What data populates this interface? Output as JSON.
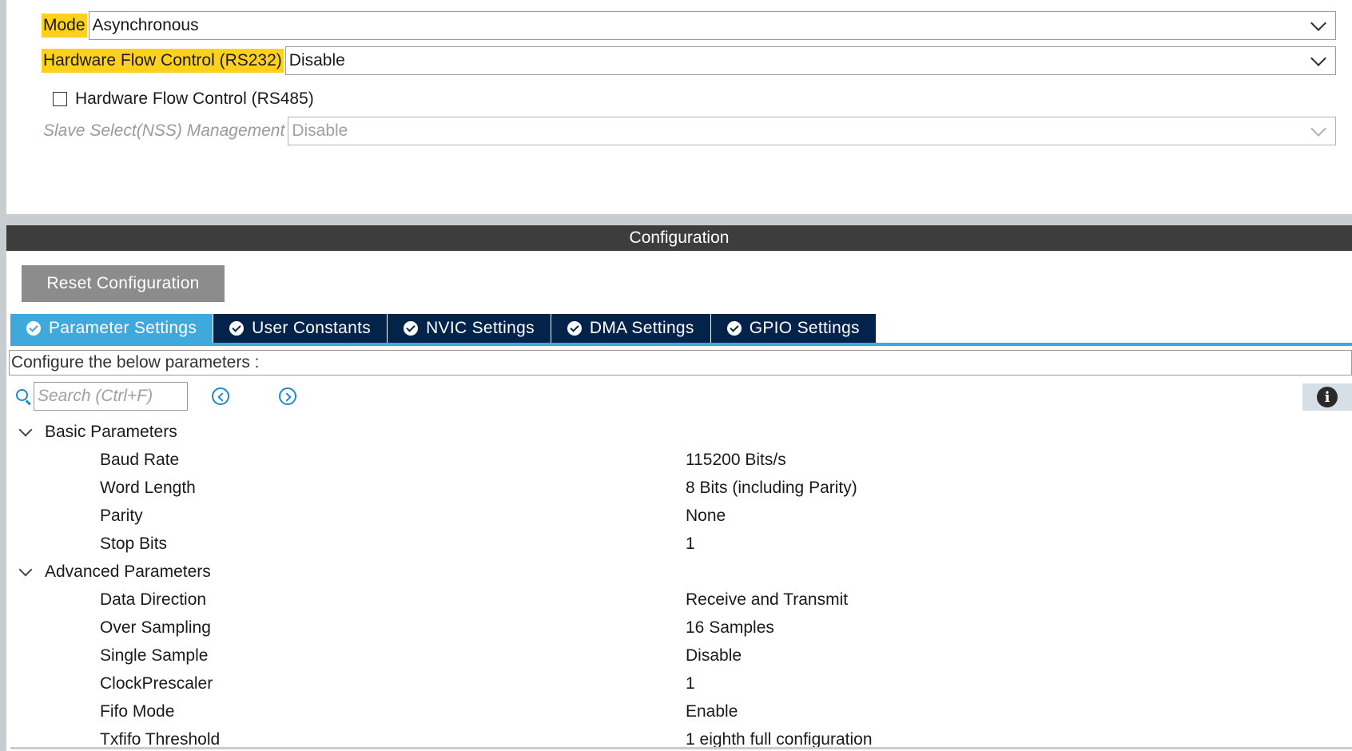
{
  "mode_panel": {
    "mode_label": "Mode",
    "mode_value": "Asynchronous",
    "hw_flow_rs232_label": "Hardware Flow Control (RS232)",
    "hw_flow_rs232_value": "Disable",
    "hw_flow_rs485_label": "Hardware Flow Control (RS485)",
    "hw_flow_rs485_checked": false,
    "nss_label": "Slave Select(NSS) Management",
    "nss_value": "Disable"
  },
  "configuration": {
    "header": "Configuration",
    "reset_button": "Reset Configuration",
    "tabs": [
      {
        "label": "Parameter Settings",
        "active": true
      },
      {
        "label": "User Constants",
        "active": false
      },
      {
        "label": "NVIC Settings",
        "active": false
      },
      {
        "label": "DMA Settings",
        "active": false
      },
      {
        "label": "GPIO Settings",
        "active": false
      }
    ],
    "instruction": "Configure the below parameters :",
    "search_placeholder": "Search (Ctrl+F)",
    "info_glyph": "i"
  },
  "parameters": {
    "basic": {
      "title": "Basic Parameters",
      "rows": [
        {
          "name": "Baud Rate",
          "value": "115200 Bits/s"
        },
        {
          "name": "Word Length",
          "value": "8 Bits (including Parity)"
        },
        {
          "name": "Parity",
          "value": "None"
        },
        {
          "name": "Stop Bits",
          "value": "1"
        }
      ]
    },
    "advanced": {
      "title": "Advanced Parameters",
      "rows": [
        {
          "name": "Data Direction",
          "value": "Receive and Transmit"
        },
        {
          "name": "Over Sampling",
          "value": "16 Samples"
        },
        {
          "name": "Single Sample",
          "value": "Disable"
        },
        {
          "name": "ClockPrescaler",
          "value": "1"
        },
        {
          "name": "Fifo Mode",
          "value": "Enable"
        },
        {
          "name": "Txfifo Threshold",
          "value": "1 eighth full configuration"
        }
      ]
    }
  },
  "colors": {
    "highlight": "#ffd11a",
    "tab_active": "#3fa9dc",
    "tab_inactive": "#03234b",
    "header_bar": "#3d3d3d",
    "reset_button": "#8c8c8c"
  }
}
